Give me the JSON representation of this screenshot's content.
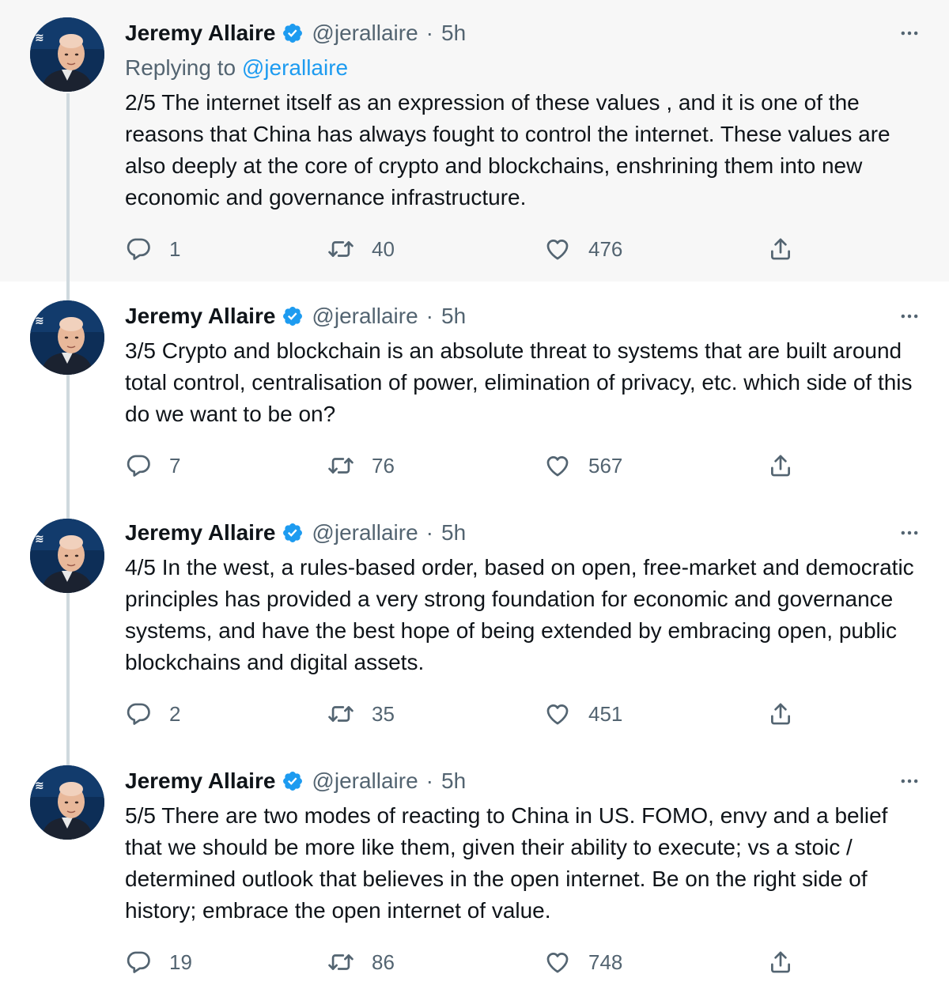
{
  "replying_label": "Replying to",
  "replying_handle": "@jerallaire",
  "tweets": [
    {
      "name": "Jeremy Allaire",
      "handle": "@jerallaire",
      "separator": "·",
      "time": "5h",
      "text": "2/5 The internet itself as an expression of these values , and it is one of the reasons that China has always fought to control the internet.  These values are also deeply at the core of crypto and blockchains, enshrining them into new economic and governance infrastructure.",
      "replies": "1",
      "retweets": "40",
      "likes": "476"
    },
    {
      "name": "Jeremy Allaire",
      "handle": "@jerallaire",
      "separator": "·",
      "time": "5h",
      "text": "3/5 Crypto and blockchain is an absolute threat to systems that are built around total control, centralisation of power, elimination of privacy, etc. which side of this do we want to be on?",
      "replies": "7",
      "retweets": "76",
      "likes": "567"
    },
    {
      "name": "Jeremy Allaire",
      "handle": "@jerallaire",
      "separator": "·",
      "time": "5h",
      "text": "4/5 In the west, a rules-based order, based on open, free-market and democratic principles has provided a very strong foundation for economic and governance systems, and have the best hope of being extended by embracing open, public blockchains and digital assets.",
      "replies": "2",
      "retweets": "35",
      "likes": "451"
    },
    {
      "name": "Jeremy Allaire",
      "handle": "@jerallaire",
      "separator": "·",
      "time": "5h",
      "text": "5/5 There are two modes of reacting to China in US.  FOMO, envy and a belief that we should be more like them, given their ability to execute; vs a stoic / determined outlook that believes in the open internet.  Be on the right side of history; embrace the open internet of value.",
      "replies": "19",
      "retweets": "86",
      "likes": "748"
    }
  ],
  "colors": {
    "text": "#0f1419",
    "secondary": "#536471",
    "accent": "#1d9bf0",
    "highlight_bg": "#f7f7f7",
    "thread_line": "#cfd9de"
  },
  "icons": [
    "verified-badge-icon",
    "more-icon",
    "reply-icon",
    "retweet-icon",
    "like-icon",
    "share-icon"
  ]
}
